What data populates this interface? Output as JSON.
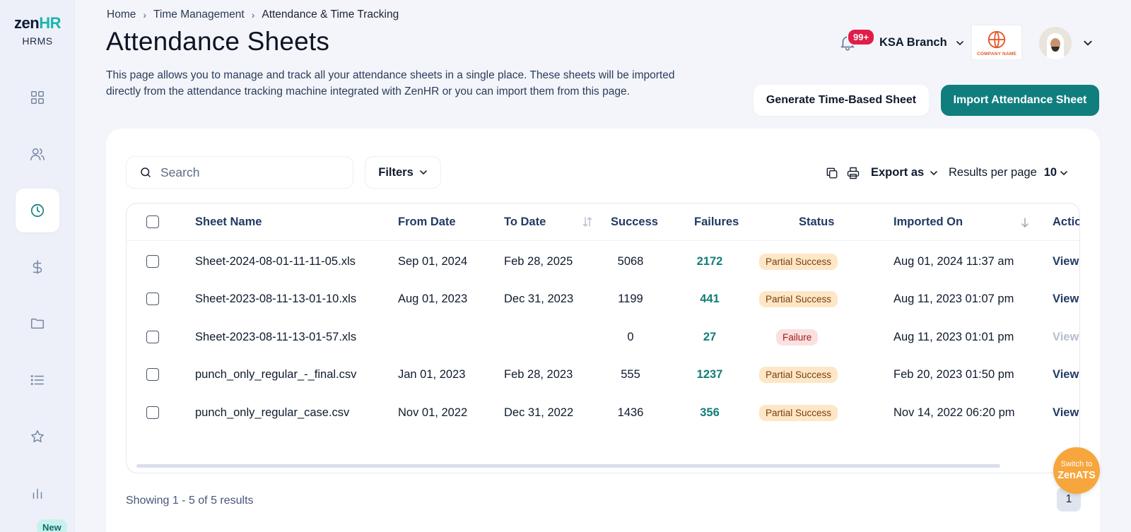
{
  "app": {
    "logo_main": "zen",
    "logo_accent": "HR",
    "logo_sub": "HRMS"
  },
  "sidebar": {
    "items": [
      {
        "name": "dashboard",
        "icon": "grid-icon"
      },
      {
        "name": "employees",
        "icon": "users-icon"
      },
      {
        "name": "time",
        "icon": "clock-icon",
        "active": true
      },
      {
        "name": "payroll",
        "icon": "dollar-icon"
      },
      {
        "name": "documents",
        "icon": "folder-icon"
      },
      {
        "name": "lists",
        "icon": "list-icon"
      },
      {
        "name": "favorites",
        "icon": "star-icon"
      },
      {
        "name": "reports",
        "icon": "bar-chart-icon"
      }
    ],
    "new_badge": "New"
  },
  "breadcrumb": {
    "home": "Home",
    "section": "Time Management",
    "current": "Attendance & Time Tracking"
  },
  "page": {
    "title": "Attendance Sheets",
    "description": "This page allows you to manage and track all your attendance sheets in a single place. These sheets will be imported directly from the attendance tracking machine integrated with ZenHR or you can import them from this page."
  },
  "header": {
    "notifications": "99+",
    "branch": "KSA Branch",
    "company_name": "COMPANY NAME"
  },
  "actions": {
    "generate": "Generate Time-Based Sheet",
    "import": "Import Attendance Sheet"
  },
  "toolbar": {
    "search_placeholder": "Search",
    "filters": "Filters",
    "export": "Export as",
    "rpp_label": "Results per page",
    "rpp_value": "10"
  },
  "table": {
    "headers": {
      "sheet_name": "Sheet Name",
      "from_date": "From Date",
      "to_date": "To Date",
      "success": "Success",
      "failures": "Failures",
      "status": "Status",
      "imported_on": "Imported On",
      "actions": "Actions"
    },
    "rows": [
      {
        "sheet": "Sheet-2024-08-01-11-11-05.xls",
        "from": "Sep 01, 2024",
        "to": "Feb 28, 2025",
        "success": "5068",
        "failures": "2172",
        "status": "Partial Success",
        "status_type": "partial",
        "imported": "Aug 01, 2024 11:37 am",
        "action": "View",
        "action_enabled": true
      },
      {
        "sheet": "Sheet-2023-08-11-13-01-10.xls",
        "from": "Aug 01, 2023",
        "to": "Dec 31, 2023",
        "success": "1199",
        "failures": "441",
        "status": "Partial Success",
        "status_type": "partial",
        "imported": "Aug 11, 2023 01:07 pm",
        "action": "View",
        "action_enabled": true
      },
      {
        "sheet": "Sheet-2023-08-11-13-01-57.xls",
        "from": "",
        "to": "",
        "success": "0",
        "failures": "27",
        "status": "Failure",
        "status_type": "failure",
        "imported": "Aug 11, 2023 01:01 pm",
        "action": "View",
        "action_enabled": false
      },
      {
        "sheet": "punch_only_regular_-_final.csv",
        "from": "Jan 01, 2023",
        "to": "Feb 28, 2023",
        "success": "555",
        "failures": "1237",
        "status": "Partial Success",
        "status_type": "partial",
        "imported": "Feb 20, 2023 01:50 pm",
        "action": "View",
        "action_enabled": true
      },
      {
        "sheet": "punch_only_regular_case.csv",
        "from": "Nov 01, 2022",
        "to": "Dec 31, 2022",
        "success": "1436",
        "failures": "356",
        "status": "Partial Success",
        "status_type": "partial",
        "imported": "Nov 14, 2022 06:20 pm",
        "action": "View",
        "action_enabled": true
      }
    ]
  },
  "footer": {
    "showing": "Showing 1 - 5 of 5 results",
    "page": "1",
    "zenats_line1": "Switch to",
    "zenats_line2": "ZenATS"
  },
  "colors": {
    "primary": "#107e7d",
    "accent": "#19b5b0",
    "header_text": "#213a64",
    "zenats": "#f6a63c"
  }
}
